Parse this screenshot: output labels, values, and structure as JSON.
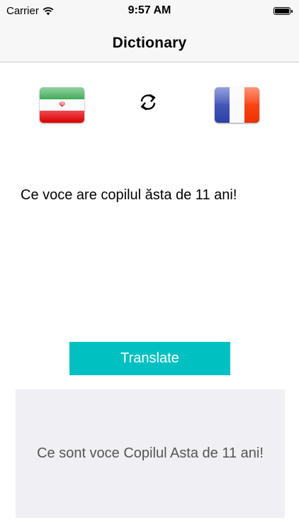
{
  "status_bar": {
    "carrier": "Carrier",
    "time": "9:57 AM"
  },
  "nav": {
    "title": "Dictionary"
  },
  "languages": {
    "source_flag": "iran-flag",
    "target_flag": "france-flag",
    "swap_icon": "swap-arrows-icon"
  },
  "input": {
    "text": "Ce voce are copilul ăsta de 11 ani!"
  },
  "actions": {
    "translate_label": "Translate"
  },
  "result": {
    "text": "Ce sont voce Copilul Asta de 11 ani!"
  },
  "colors": {
    "accent": "#00c0c2",
    "result_background": "#efeff4",
    "bar_background": "#f7f7f7"
  }
}
